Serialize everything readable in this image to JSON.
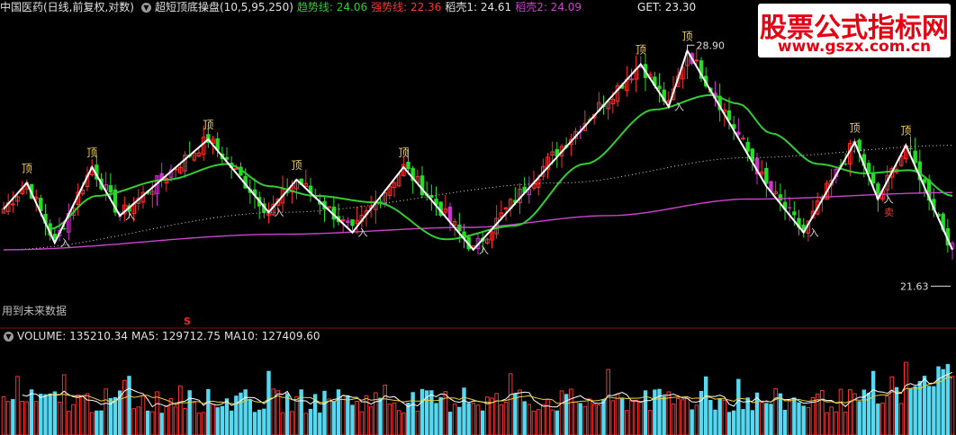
{
  "header": {
    "stock": "中国医药(日线,前复权,对数)",
    "indicator": "超短顶底操盘(10,5,95,250)",
    "trend_label": "趋势线: 24.06",
    "strong_label": "强势线: 22.36",
    "shell1_label": "稻壳1: 24.61",
    "shell2_label": "稻壳2: 24.09",
    "get_label": "GET: 23.30",
    "trend_color": "#33cc33",
    "strong_color": "#ff3333",
    "shell1_color": "#e0e0e0",
    "shell2_color": "#cc44cc"
  },
  "watermark": {
    "title": "股票公式指标网",
    "url": "www.gszx.com.cn"
  },
  "notes": {
    "future_data": "用到未来数据",
    "s_mark": "S"
  },
  "volume_header": {
    "volume": "VOLUME: 135210.34",
    "ma5": "MA5: 129712.75",
    "ma10": "MA10: 127409.60"
  },
  "chart_data": {
    "type": "candlestick",
    "price_range": [
      20.5,
      30.2
    ],
    "scale": "log",
    "labels": {
      "high": "28.90",
      "low": "21.63",
      "top": "顶",
      "entry": "入",
      "sell": "卖"
    },
    "zigzag": [
      {
        "i": 0,
        "v": 23.6
      },
      {
        "i": 5,
        "v": 24.4
      },
      {
        "i": 11,
        "v": 22.6
      },
      {
        "i": 19,
        "v": 24.9
      },
      {
        "i": 25,
        "v": 23.4
      },
      {
        "i": 44,
        "v": 25.8
      },
      {
        "i": 57,
        "v": 23.5
      },
      {
        "i": 63,
        "v": 24.5
      },
      {
        "i": 75,
        "v": 22.9
      },
      {
        "i": 86,
        "v": 24.9
      },
      {
        "i": 101,
        "v": 22.4
      },
      {
        "i": 137,
        "v": 28.4
      },
      {
        "i": 143,
        "v": 26.9
      },
      {
        "i": 147,
        "v": 28.9
      },
      {
        "i": 164,
        "v": 24.3
      },
      {
        "i": 172,
        "v": 22.9
      },
      {
        "i": 183,
        "v": 25.7
      },
      {
        "i": 188,
        "v": 23.9
      },
      {
        "i": 194,
        "v": 25.6
      },
      {
        "i": 204,
        "v": 22.4
      }
    ],
    "green_line_anchors": [
      {
        "i": 10,
        "v": 23.0
      },
      {
        "i": 20,
        "v": 24.0
      },
      {
        "i": 35,
        "v": 24.5
      },
      {
        "i": 48,
        "v": 25.0
      },
      {
        "i": 57,
        "v": 24.3
      },
      {
        "i": 67,
        "v": 24.0
      },
      {
        "i": 80,
        "v": 23.8
      },
      {
        "i": 95,
        "v": 22.7
      },
      {
        "i": 110,
        "v": 23.1
      },
      {
        "i": 125,
        "v": 25.0
      },
      {
        "i": 140,
        "v": 26.8
      },
      {
        "i": 152,
        "v": 27.3
      },
      {
        "i": 158,
        "v": 27.0
      },
      {
        "i": 165,
        "v": 26.0
      },
      {
        "i": 175,
        "v": 25.0
      },
      {
        "i": 185,
        "v": 24.7
      },
      {
        "i": 195,
        "v": 24.8
      },
      {
        "i": 204,
        "v": 24.0
      }
    ],
    "purple_line_anchors": [
      {
        "i": 0,
        "v": 22.4
      },
      {
        "i": 60,
        "v": 22.85
      },
      {
        "i": 100,
        "v": 23.05
      },
      {
        "i": 130,
        "v": 23.4
      },
      {
        "i": 160,
        "v": 23.9
      },
      {
        "i": 204,
        "v": 24.1
      }
    ],
    "dotted_line_anchors": [
      {
        "i": 0,
        "v": 22.4
      },
      {
        "i": 60,
        "v": 23.5
      },
      {
        "i": 120,
        "v": 24.4
      },
      {
        "i": 160,
        "v": 25.2
      },
      {
        "i": 204,
        "v": 25.6
      }
    ]
  }
}
